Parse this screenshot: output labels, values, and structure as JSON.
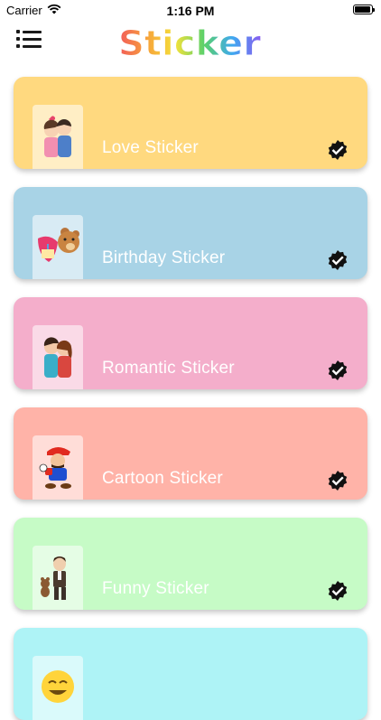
{
  "status_bar": {
    "carrier": "Carrier",
    "time": "1:16 PM"
  },
  "header": {
    "logo_text": "Sticker",
    "menu_icon": "list-icon"
  },
  "categories": [
    {
      "label": "Love Sticker",
      "color": "#FFD97F",
      "thumb_icon": "couple-icon"
    },
    {
      "label": "Birthday Sticker",
      "color": "#A8D3E6",
      "thumb_icon": "teddy-bear-icon"
    },
    {
      "label": "Romantic Sticker",
      "color": "#F4AECB",
      "thumb_icon": "kissing-couple-icon"
    },
    {
      "label": "Cartoon Sticker",
      "color": "#FFB3A8",
      "thumb_icon": "mario-icon"
    },
    {
      "label": "Funny Sticker",
      "color": "#C6FBC6",
      "thumb_icon": "mr-bean-icon"
    },
    {
      "label": "",
      "color": "#AEF3F6",
      "thumb_icon": "emoji-icon"
    }
  ],
  "badge_icon": "verified-check-icon"
}
